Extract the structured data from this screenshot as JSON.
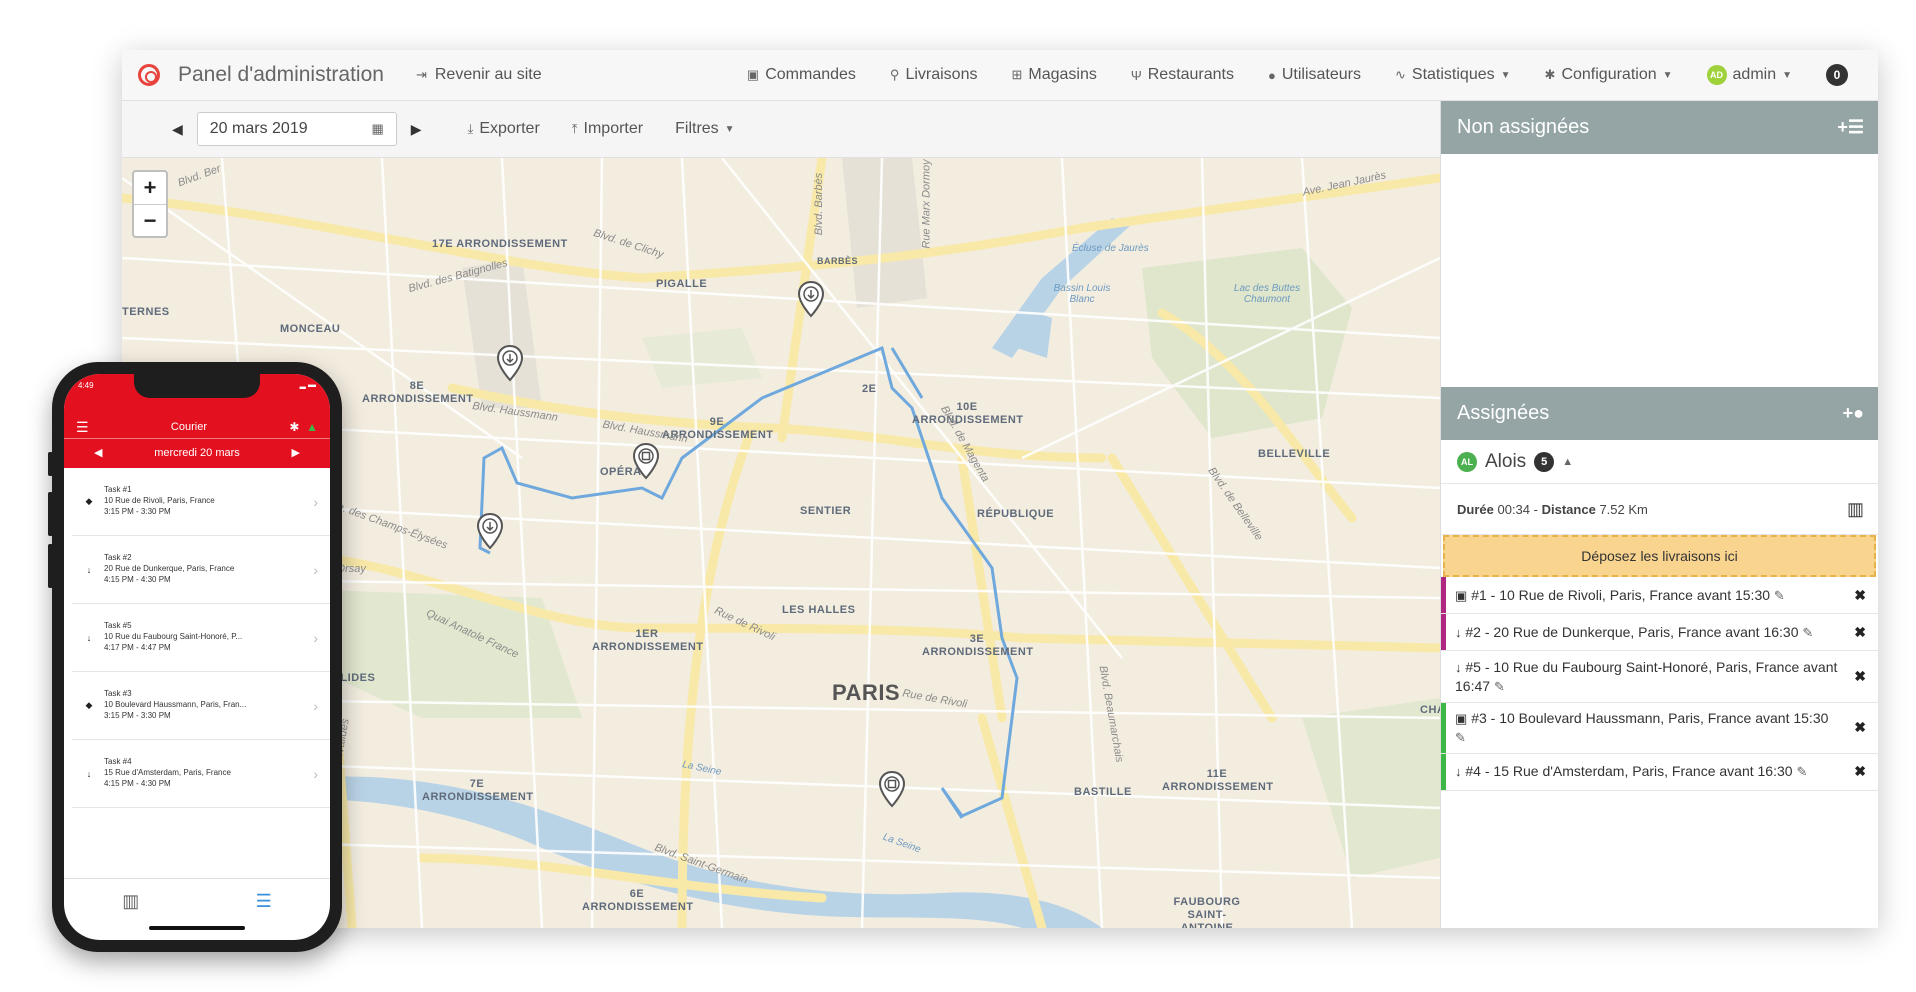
{
  "navbar": {
    "title": "Panel d'administration",
    "back_label": "Revenir au site",
    "items": [
      {
        "icon": "cube-icon",
        "label": "Commandes"
      },
      {
        "icon": "bicycle-icon",
        "label": "Livraisons"
      },
      {
        "icon": "cart-icon",
        "label": "Magasins"
      },
      {
        "icon": "cutlery-icon",
        "label": "Restaurants"
      },
      {
        "icon": "user-icon",
        "label": "Utilisateurs"
      },
      {
        "icon": "chart-icon",
        "label": "Statistiques"
      },
      {
        "icon": "gear-icon",
        "label": "Configuration"
      }
    ],
    "user_initials": "AD",
    "user_name": "admin",
    "notifications": "0"
  },
  "toolbar": {
    "date": "20 mars 2019",
    "export_label": "Exporter",
    "import_label": "Importer",
    "filters_label": "Filtres"
  },
  "map": {
    "zoom_in": "+",
    "zoom_out": "−",
    "districts": [
      "17E ARRONDISSEMENT",
      "8E ARRONDISSEMENT",
      "9E ARRONDISSEMENT",
      "10E ARRONDISSEMENT",
      "1ER ARRONDISSEMENT",
      "3E ARRONDISSEMENT",
      "7E ARRONDISSEMENT",
      "11E ARRONDISSEMENT",
      "6E ARRONDISSEMENT"
    ],
    "places": [
      "TERNES",
      "MONCEAU",
      "PIGALLE",
      "BARBÈS",
      "OPÉRA",
      "SENTIER",
      "RÉPUBLIQUE",
      "BELLEVILLE",
      "LES HALLES",
      "BASTILLE",
      "FAUBOURG SAINT-ANTOINE",
      "PARIS",
      "2E",
      "CHA",
      "ALIDES"
    ],
    "streets": [
      "Blvd. Ber",
      "Blvd. de Clichy",
      "Blvd. des Batignolles",
      "Blvd. Haussmann",
      "Blvd. Haussmann",
      "Ave. des Champs-Élysées",
      "Quai Anatole France",
      "Rue de Rivoli",
      "Rue de Rivoli",
      "Blvd. Saint-Germain",
      "Blvd. Barbès",
      "Rue Marx Dormoy",
      "Ave. Jean Jaurès",
      "Blvd. de Belleville",
      "Blvd. Beaumarchais",
      "Blvd. des Invalides",
      "Blvd. de Magenta",
      "Quai d'Orsay"
    ],
    "water": [
      "Écluse de Jaurès",
      "Bassin Louis Blanc",
      "Lac des Buttes Chaumont",
      "La Seine",
      "La Seine"
    ]
  },
  "unassigned": {
    "title": "Non assignées"
  },
  "assigned": {
    "title": "Assignées",
    "courier_initials": "AL",
    "courier_name": "Alois",
    "task_count": "5",
    "duration_label": "Durée",
    "duration": "00:34",
    "separator": "-",
    "distance_label": "Distance",
    "distance": "7.52 Km",
    "drop_label": "Déposez les livraisons ici",
    "tasks": [
      {
        "icon": "cube-icon",
        "text": "#1 - 10 Rue de Rivoli, Paris, France avant 15:30",
        "color": "#b0287f"
      },
      {
        "icon": "arrow-down-icon",
        "text": "#2 - 20 Rue de Dunkerque, Paris, France avant 16:30",
        "color": "#b0287f"
      },
      {
        "icon": "arrow-down-icon",
        "text": "#5 - 10 Rue du Faubourg Saint-Honoré, Paris, France avant 16:47",
        "color": ""
      },
      {
        "icon": "cube-icon",
        "text": "#3 - 10 Boulevard Haussmann, Paris, France avant 15:30",
        "color": "#3cb846"
      },
      {
        "icon": "arrow-down-icon",
        "text": "#4 - 15 Rue d'Amsterdam, Paris, France avant 16:30",
        "color": "#3cb846"
      }
    ]
  },
  "phone": {
    "time": "4:49",
    "title": "Courier",
    "date": "mercredi 20 mars",
    "tasks": [
      {
        "icon": "cube-icon",
        "title": "Task #1",
        "address": "10 Rue de Rivoli, Paris, France",
        "time": "3:15 PM - 3:30 PM"
      },
      {
        "icon": "arrow-down-icon",
        "title": "Task #2",
        "address": "20 Rue de Dunkerque, Paris, France",
        "time": "4:15 PM - 4:30 PM"
      },
      {
        "icon": "arrow-down-icon",
        "title": "Task #5",
        "address": "10 Rue du Faubourg Saint-Honoré, P...",
        "time": "4:17 PM - 4:47 PM"
      },
      {
        "icon": "cube-icon",
        "title": "Task #3",
        "address": "10 Boulevard Haussmann, Paris, Fran...",
        "time": "3:15 PM - 3:30 PM"
      },
      {
        "icon": "arrow-down-icon",
        "title": "Task #4",
        "address": "15 Rue d'Amsterdam, Paris, France",
        "time": "4:15 PM - 4:30 PM"
      }
    ]
  },
  "colors": {
    "accent_red": "#e3111f",
    "panel_header": "#95a5a6",
    "route": "#6fa8dc",
    "drop_zone": "#f9d48f"
  }
}
